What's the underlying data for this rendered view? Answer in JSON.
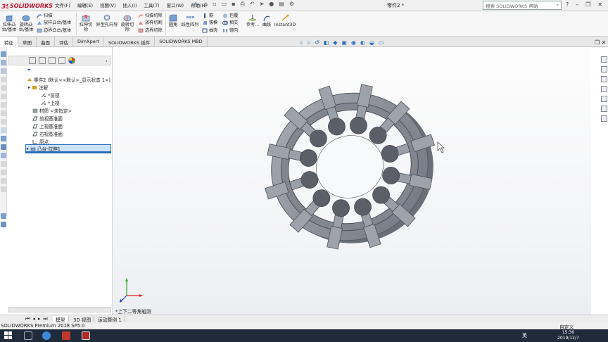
{
  "app": {
    "brand": "SOLIDWORKS",
    "document_title": "零件2 *",
    "search_placeholder": "搜索 SOLIDWORKS 帮助"
  },
  "menus": [
    "文件(F)",
    "编辑(E)",
    "视图(V)",
    "插入(I)",
    "工具(T)",
    "窗口(W)",
    "帮助(H)"
  ],
  "ribbon": {
    "extrude_boss": "拉伸凸\n台/基体",
    "revolve_boss": "旋转凸\n台/基体",
    "sweep": "扫描",
    "loft_boss": "放样凸台/基体",
    "boundary_boss": "边界凸台/基体",
    "extrude_cut": "拉伸切\n除",
    "hole_wizard": "异型孔向导",
    "revolve_cut": "旋转切\n除",
    "swept_cut": "扫描切除",
    "lofted_cut": "放样切割",
    "boundary_cut": "边界切除",
    "fillet": "圆角",
    "linear_pattern": "线性阵列",
    "rib": "筋",
    "draft": "拔模",
    "shell": "抽壳",
    "wrap": "包覆",
    "intersect": "相交",
    "mirror": "镜向",
    "reference": "参考...",
    "curves": "曲线",
    "instant3d": "Instant3D"
  },
  "tabs": [
    "特征",
    "草图",
    "曲面",
    "评估",
    "DimXpert",
    "SOLIDWORKS 插件",
    "SOLIDWORKS MBD"
  ],
  "tree": {
    "part": "零件2 (默认<<默认>_显示状态 1>)",
    "annotations": "注解",
    "front_note": "*前视",
    "top_note": "*上视",
    "material": "材质 <未指定>",
    "front_plane": "前视基准面",
    "top_plane": "上视基准面",
    "right_plane": "右视基准面",
    "origin": "原点",
    "boss_extrude": "凸台-拉伸1"
  },
  "viewport": {
    "view_label": "*上下二等角轴测"
  },
  "bottom_tabs": [
    "模型",
    "3D 视图",
    "运动算例 1"
  ],
  "status": {
    "left": "SOLIDWORKS Premium 2018 SP5.0",
    "right": "自定义"
  },
  "taskbar": {
    "time": "15:36",
    "date": "2019/12/7",
    "lang": "英"
  },
  "colors": {
    "brand_red": "#c8102e",
    "accent_blue": "#2a6ebb",
    "model_gray": "#8f949d",
    "taskbar": "#1f2b3a"
  }
}
